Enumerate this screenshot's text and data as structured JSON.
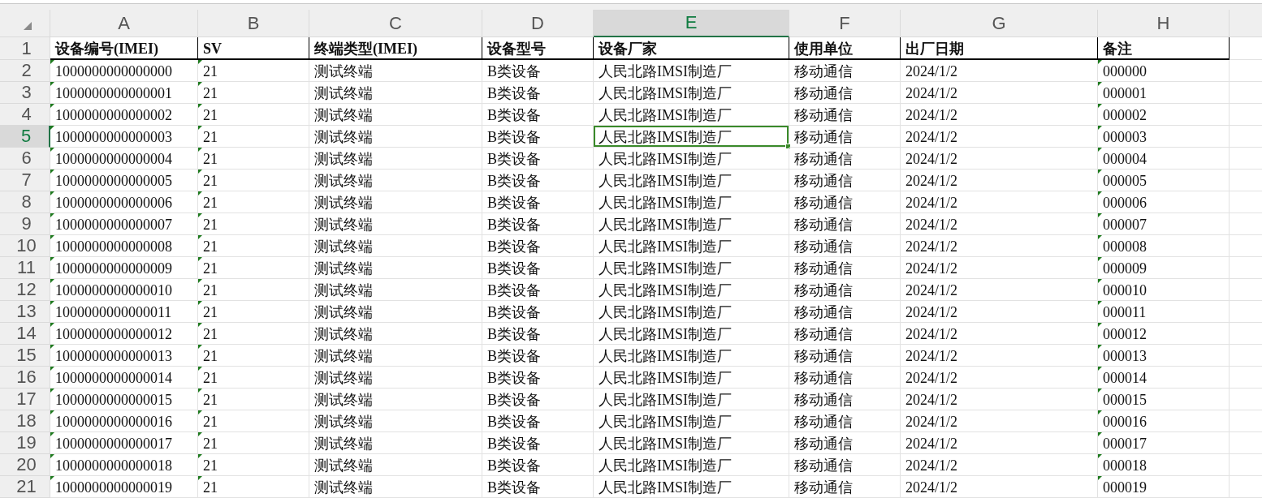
{
  "columns": [
    {
      "letter": "A",
      "selected": false,
      "text_flag": true
    },
    {
      "letter": "B",
      "selected": false,
      "text_flag": true
    },
    {
      "letter": "C",
      "selected": false,
      "text_flag": false
    },
    {
      "letter": "D",
      "selected": false,
      "text_flag": false
    },
    {
      "letter": "E",
      "selected": true,
      "text_flag": false
    },
    {
      "letter": "F",
      "selected": false,
      "text_flag": false
    },
    {
      "letter": "G",
      "selected": false,
      "text_flag": false
    },
    {
      "letter": "H",
      "selected": false,
      "text_flag": true
    }
  ],
  "header_row": {
    "number": "1",
    "cells": [
      "设备编号(IMEI)",
      "SV",
      "终端类型(IMEI)",
      "设备型号",
      "设备厂家",
      "使用单位",
      "出厂日期",
      "备注"
    ]
  },
  "rows": [
    {
      "number": "2",
      "selected": false,
      "cells": [
        "1000000000000000",
        "21",
        "测试终端",
        "B类设备",
        "人民北路IMSI制造厂",
        "移动通信",
        "2024/1/2",
        "000000"
      ]
    },
    {
      "number": "3",
      "selected": false,
      "cells": [
        "1000000000000001",
        "21",
        "测试终端",
        "B类设备",
        "人民北路IMSI制造厂",
        "移动通信",
        "2024/1/2",
        "000001"
      ]
    },
    {
      "number": "4",
      "selected": false,
      "cells": [
        "1000000000000002",
        "21",
        "测试终端",
        "B类设备",
        "人民北路IMSI制造厂",
        "移动通信",
        "2024/1/2",
        "000002"
      ]
    },
    {
      "number": "5",
      "selected": true,
      "cells": [
        "1000000000000003",
        "21",
        "测试终端",
        "B类设备",
        "人民北路IMSI制造厂",
        "移动通信",
        "2024/1/2",
        "000003"
      ]
    },
    {
      "number": "6",
      "selected": false,
      "cells": [
        "1000000000000004",
        "21",
        "测试终端",
        "B类设备",
        "人民北路IMSI制造厂",
        "移动通信",
        "2024/1/2",
        "000004"
      ]
    },
    {
      "number": "7",
      "selected": false,
      "cells": [
        "1000000000000005",
        "21",
        "测试终端",
        "B类设备",
        "人民北路IMSI制造厂",
        "移动通信",
        "2024/1/2",
        "000005"
      ]
    },
    {
      "number": "8",
      "selected": false,
      "cells": [
        "1000000000000006",
        "21",
        "测试终端",
        "B类设备",
        "人民北路IMSI制造厂",
        "移动通信",
        "2024/1/2",
        "000006"
      ]
    },
    {
      "number": "9",
      "selected": false,
      "cells": [
        "1000000000000007",
        "21",
        "测试终端",
        "B类设备",
        "人民北路IMSI制造厂",
        "移动通信",
        "2024/1/2",
        "000007"
      ]
    },
    {
      "number": "10",
      "selected": false,
      "cells": [
        "1000000000000008",
        "21",
        "测试终端",
        "B类设备",
        "人民北路IMSI制造厂",
        "移动通信",
        "2024/1/2",
        "000008"
      ]
    },
    {
      "number": "11",
      "selected": false,
      "cells": [
        "1000000000000009",
        "21",
        "测试终端",
        "B类设备",
        "人民北路IMSI制造厂",
        "移动通信",
        "2024/1/2",
        "000009"
      ]
    },
    {
      "number": "12",
      "selected": false,
      "cells": [
        "1000000000000010",
        "21",
        "测试终端",
        "B类设备",
        "人民北路IMSI制造厂",
        "移动通信",
        "2024/1/2",
        "000010"
      ]
    },
    {
      "number": "13",
      "selected": false,
      "cells": [
        "1000000000000011",
        "21",
        "测试终端",
        "B类设备",
        "人民北路IMSI制造厂",
        "移动通信",
        "2024/1/2",
        "000011"
      ]
    },
    {
      "number": "14",
      "selected": false,
      "cells": [
        "1000000000000012",
        "21",
        "测试终端",
        "B类设备",
        "人民北路IMSI制造厂",
        "移动通信",
        "2024/1/2",
        "000012"
      ]
    },
    {
      "number": "15",
      "selected": false,
      "cells": [
        "1000000000000013",
        "21",
        "测试终端",
        "B类设备",
        "人民北路IMSI制造厂",
        "移动通信",
        "2024/1/2",
        "000013"
      ]
    },
    {
      "number": "16",
      "selected": false,
      "cells": [
        "1000000000000014",
        "21",
        "测试终端",
        "B类设备",
        "人民北路IMSI制造厂",
        "移动通信",
        "2024/1/2",
        "000014"
      ]
    },
    {
      "number": "17",
      "selected": false,
      "cells": [
        "1000000000000015",
        "21",
        "测试终端",
        "B类设备",
        "人民北路IMSI制造厂",
        "移动通信",
        "2024/1/2",
        "000015"
      ]
    },
    {
      "number": "18",
      "selected": false,
      "cells": [
        "1000000000000016",
        "21",
        "测试终端",
        "B类设备",
        "人民北路IMSI制造厂",
        "移动通信",
        "2024/1/2",
        "000016"
      ]
    },
    {
      "number": "19",
      "selected": false,
      "cells": [
        "1000000000000017",
        "21",
        "测试终端",
        "B类设备",
        "人民北路IMSI制造厂",
        "移动通信",
        "2024/1/2",
        "000017"
      ]
    },
    {
      "number": "20",
      "selected": false,
      "cells": [
        "1000000000000018",
        "21",
        "测试终端",
        "B类设备",
        "人民北路IMSI制造厂",
        "移动通信",
        "2024/1/2",
        "000018"
      ]
    },
    {
      "number": "21",
      "selected": false,
      "cells": [
        "1000000000000019",
        "21",
        "测试终端",
        "B类设备",
        "人民北路IMSI制造厂",
        "移动通信",
        "2024/1/2",
        "000019"
      ]
    }
  ]
}
